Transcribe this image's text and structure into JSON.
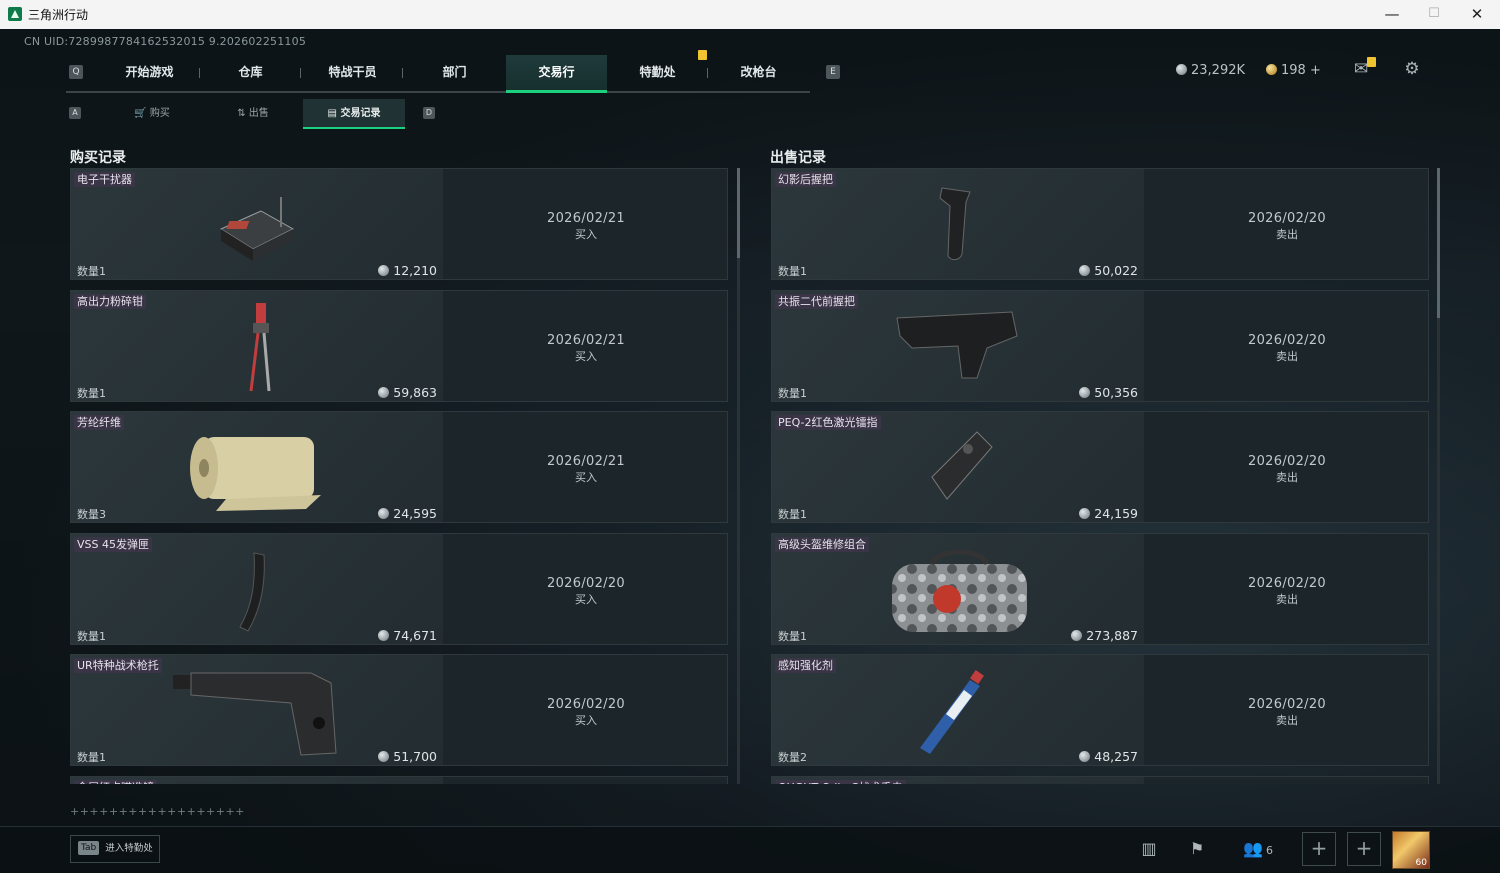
{
  "window": {
    "title": "三角洲行动",
    "minimize": "—",
    "maximize": "☐",
    "close": "✕"
  },
  "uid": "CN UID:7289987784162532015 9.202602251105",
  "nav": {
    "left_key": "Q",
    "right_key": "E",
    "tabs": [
      "开始游戏",
      "仓库",
      "特战干员",
      "部门",
      "交易行",
      "特勤处",
      "改枪台"
    ],
    "active": "交易行"
  },
  "subnav": {
    "left_key": "A",
    "right_key": "D",
    "tabs": [
      {
        "icon": "cart-icon",
        "label": "购买"
      },
      {
        "icon": "sell-icon",
        "label": "出售"
      },
      {
        "icon": "record-icon",
        "label": "交易记录"
      }
    ],
    "active": "交易记录"
  },
  "currency": {
    "silver": "23,292K",
    "gold": "198",
    "gold_add": "+"
  },
  "purchase_title": "购买记录",
  "sale_title": "出售记录",
  "purchases": [
    {
      "name": "电子干扰器",
      "qty": "数量1",
      "price": "12,210",
      "date": "2026/02/21",
      "action": "买入",
      "art": "jammer"
    },
    {
      "name": "高出力粉碎钳",
      "qty": "数量1",
      "price": "59,863",
      "date": "2026/02/21",
      "action": "买入",
      "art": "cutter"
    },
    {
      "name": "芳纶纤维",
      "qty": "数量3",
      "price": "24,595",
      "date": "2026/02/21",
      "action": "买入",
      "art": "roll"
    },
    {
      "name": "VSS 45发弹匣",
      "qty": "数量1",
      "price": "74,671",
      "date": "2026/02/20",
      "action": "买入",
      "art": "mag"
    },
    {
      "name": "UR特种战术枪托",
      "qty": "数量1",
      "price": "51,700",
      "date": "2026/02/20",
      "action": "买入",
      "art": "stock"
    },
    {
      "name": "金属红点瞄准镜",
      "qty": "",
      "price": "",
      "date": "",
      "action": "",
      "art": "none"
    }
  ],
  "sales": [
    {
      "name": "幻影后握把",
      "qty": "数量1",
      "price": "50,022",
      "date": "2026/02/20",
      "action": "卖出",
      "art": "grip"
    },
    {
      "name": "共振二代前握把",
      "qty": "数量1",
      "price": "50,356",
      "date": "2026/02/20",
      "action": "卖出",
      "art": "foregrip"
    },
    {
      "name": "PEQ-2红色激光镭指",
      "qty": "数量1",
      "price": "24,159",
      "date": "2026/02/20",
      "action": "卖出",
      "art": "laser"
    },
    {
      "name": "高级头盔维修组合",
      "qty": "数量1",
      "price": "273,887",
      "date": "2026/02/20",
      "action": "卖出",
      "art": "bag"
    },
    {
      "name": "感知强化剂",
      "qty": "数量2",
      "price": "48,257",
      "date": "2026/02/20",
      "action": "卖出",
      "art": "injector"
    },
    {
      "name": "QUGHT Odin C战术手电",
      "qty": "",
      "price": "",
      "date": "",
      "action": "",
      "art": "none"
    }
  ],
  "plus_row": "++++++++++++++++++",
  "bottom": {
    "tab_key": "Tab",
    "tab_hint": "进入特勤处",
    "team_count": "6",
    "avatar_level": "60"
  }
}
